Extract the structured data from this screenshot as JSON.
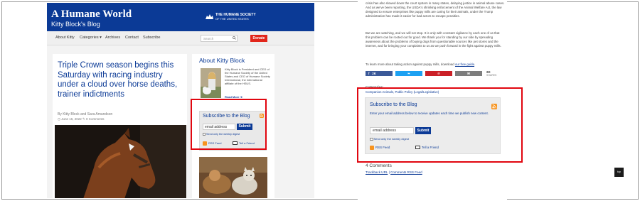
{
  "left": {
    "site_title": "A Humane World",
    "site_subtitle": "Kitty Block's Blog",
    "hsus_logo": {
      "line1": "THE HUMANE SOCIETY",
      "line2": "OF THE UNITED STATES"
    },
    "nav": {
      "items": [
        {
          "label": "About Kitty"
        },
        {
          "label": "Categories ▾"
        },
        {
          "label": "Archives"
        },
        {
          "label": "Contact"
        },
        {
          "label": "Subscribe"
        }
      ],
      "search_placeholder": "Search",
      "donate_label": "Donate"
    },
    "article": {
      "title": "Triple Crown season begins this Saturday with racing industry under a cloud over horse deaths, trainer indictments",
      "byline": "By Kitty Block and Sara Amundson",
      "date": "June 16, 2022",
      "comments": "0 Comments"
    },
    "sidebar": {
      "about_heading": "About Kitty Block",
      "bio": "Kitty Block is President and CEO of the Humane Society of the United States and CEO of Humane Society International, the international affiliate of the HSUS.",
      "read_more": "Read More"
    },
    "subscribe": {
      "title": "Subscribe to the Blog",
      "email_value": "email address",
      "submit_label": "Submit",
      "checkbox_label": "Send only the weekly digest",
      "rss_label": "RSS Feed",
      "tell_label": "Tell a Friend"
    }
  },
  "right": {
    "paragraph1": "crisis has also slowed down the court system in many states, delaying justice in animal abuse cases. And as we've been reporting, the USDA's shrinking enforcement of the Animal Welfare Act, the law designed to ensure enterprises like puppy mills are caring for their animals, under the Trump administration has made it easier for bad actors to escape penalties.",
    "paragraph2": "But we are watching, and we will not stop. It is only with constant vigilance by each one of us that this problem can be rooted out for good. We thank you for standing by our side by spreading awareness about the problems of buying dogs from questionable sources like pet stores and the internet, and for bringing your complaints to us as we push forward in the fight against puppy mills.",
    "paragraph3_prefix": "To learn more about taking action against puppy mills, download ",
    "paragraph3_link": "our free guide",
    "paragraph3_suffix": ".",
    "share": {
      "facebook_count": "2K",
      "total_count": "2K",
      "total_label": "SHARES"
    },
    "categories_label": "Categories:",
    "categories": "Companion Animals, Public Policy (Legal/Legislative)",
    "subscribe": {
      "title": "Subscribe to the Blog",
      "description": "Enter your email address below to receive updates each time we publish new content.",
      "email_value": "email address",
      "submit_label": "Submit",
      "checkbox_label": "Send only the weekly digest",
      "rss_label": "RSS Feed",
      "tell_label": "Tell a Friend"
    },
    "comments_heading": "4 Comments",
    "trackback": "Trackback URL",
    "comments_rss": "Comments RSS Feed"
  },
  "top_button": "top",
  "colors": {
    "brand_blue": "#0b3a96",
    "donate_red": "#e2261b",
    "highlight_red": "#e1060f",
    "facebook": "#3b5998",
    "twitter": "#1da1f2",
    "pinterest": "#cb2027",
    "email_gray": "#7d7d7d"
  }
}
